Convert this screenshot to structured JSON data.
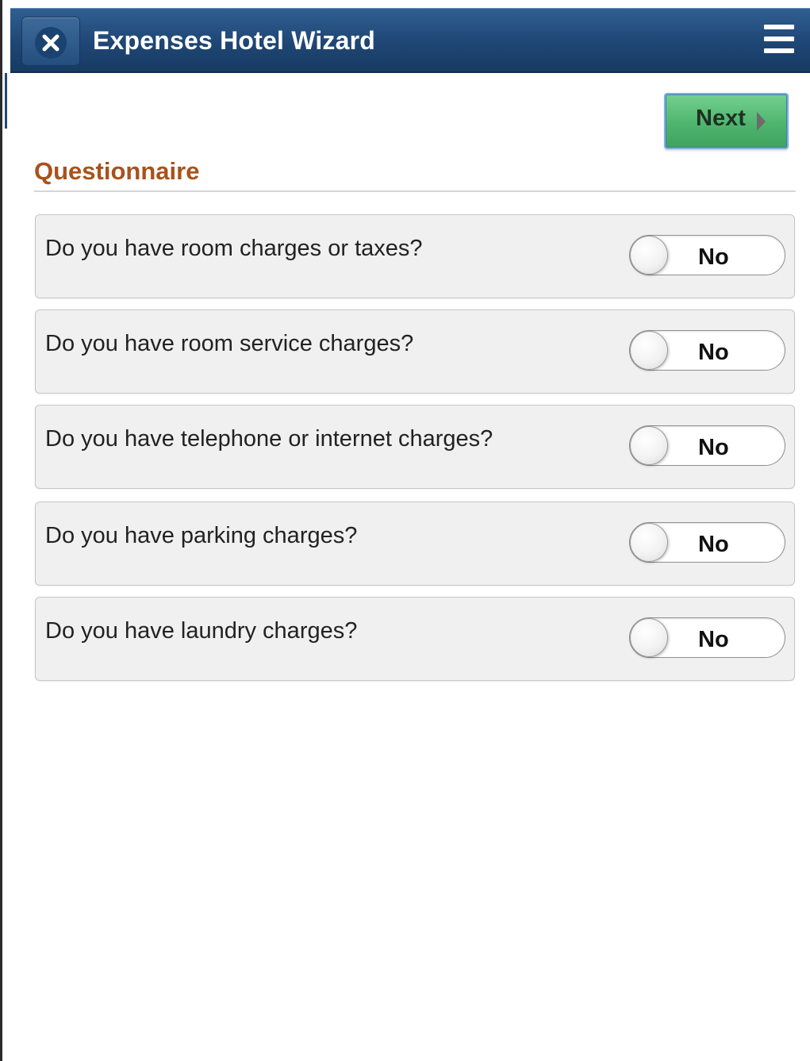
{
  "header": {
    "title": "Expenses Hotel Wizard",
    "close_icon": "close-icon",
    "menu_icon": "hamburger-menu-icon"
  },
  "toolbar": {
    "next_label": "Next",
    "next_icon": "triangle-right-icon"
  },
  "questionnaire": {
    "title": "Questionnaire",
    "items": [
      {
        "question": "Do you have room charges or taxes?",
        "answer": "No"
      },
      {
        "question": "Do you have room service charges?",
        "answer": "No"
      },
      {
        "question": "Do you have telephone or internet charges?",
        "answer": "No"
      },
      {
        "question": "Do you have parking charges?",
        "answer": "No"
      },
      {
        "question": "Do you have laundry charges?",
        "answer": "No"
      }
    ]
  },
  "colors": {
    "header_bg": "#1f4674",
    "next_button": "#4fb56e",
    "section_title": "#a8521b",
    "card_bg": "#f0f0f0"
  }
}
